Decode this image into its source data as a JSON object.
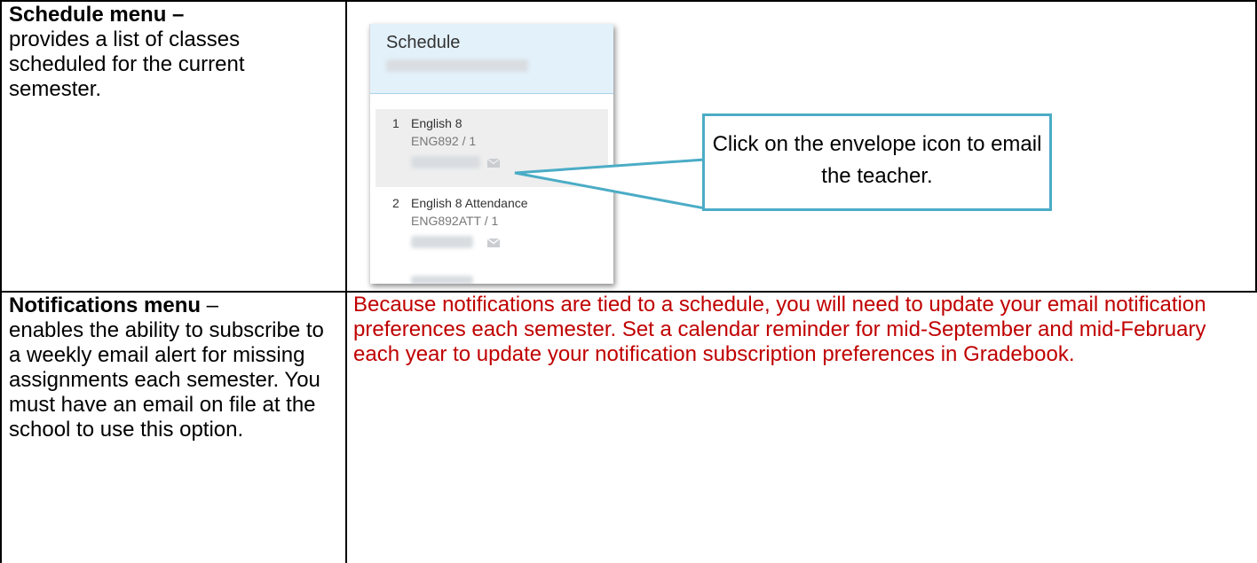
{
  "rows": [
    {
      "heading": "Schedule menu –",
      "description": "provides a list of classes scheduled for the current semester."
    },
    {
      "heading": "Notifications menu",
      "heading_suffix": " –",
      "description": "enables the ability to subscribe to a weekly email alert for missing assignments each semester. You must have an email on file at the school to use this option.",
      "note": "Because notifications are tied to a schedule, you will need to update your email notification preferences each semester. Set a calendar reminder for mid-September and mid-February each year to update your notification subscription preferences in Gradebook."
    }
  ],
  "schedule_panel": {
    "title": "Schedule",
    "courses": [
      {
        "number": "1",
        "name": "English 8",
        "code": "ENG892 / 1"
      },
      {
        "number": "2",
        "name": "English 8 Attendance",
        "code": "ENG892ATT / 1"
      }
    ],
    "icons": [
      "envelope-icon"
    ]
  },
  "callout": {
    "text": "Click on the envelope icon to email the teacher."
  },
  "colors": {
    "note_text": "#c00000",
    "callout_border": "#4bacc6",
    "panel_header": "#e3f1fa"
  }
}
